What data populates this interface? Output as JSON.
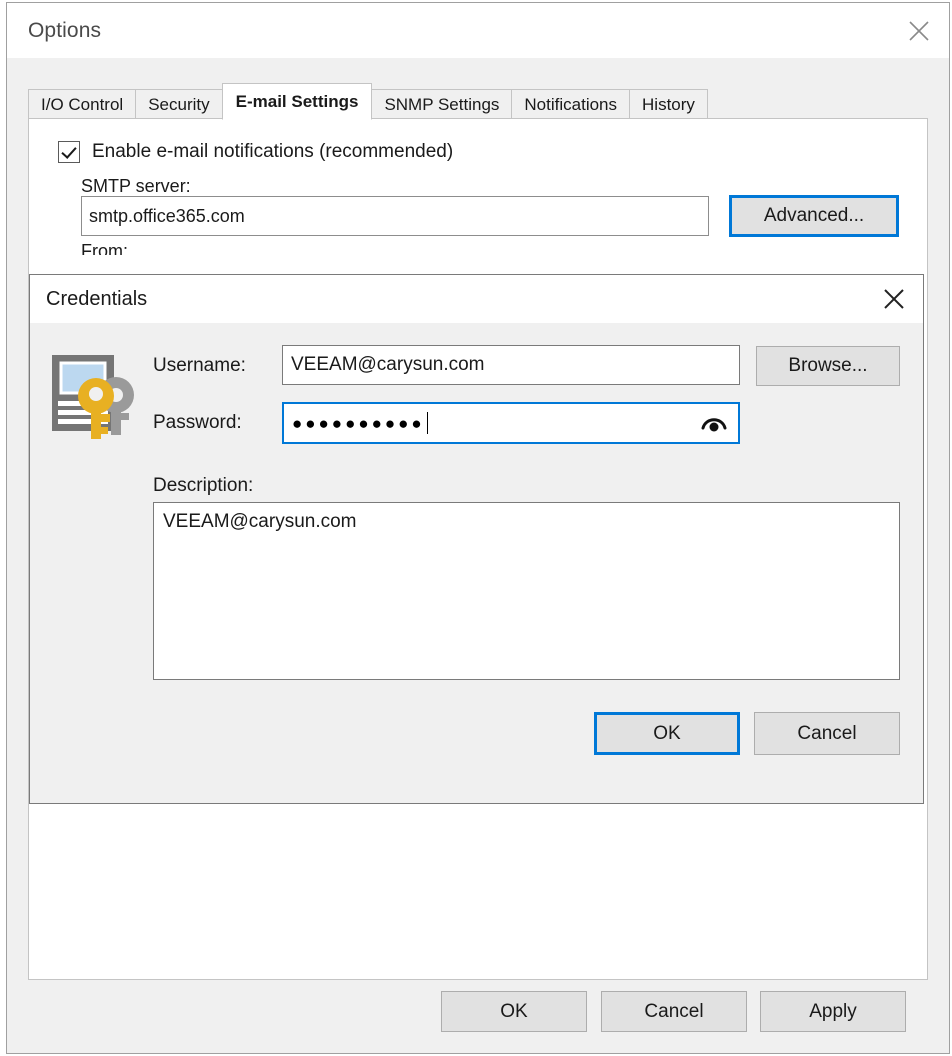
{
  "options": {
    "title": "Options",
    "close_icon": "close-icon",
    "tabs": [
      {
        "label": "I/O Control",
        "active": false
      },
      {
        "label": "Security",
        "active": false
      },
      {
        "label": "E-mail Settings",
        "active": true
      },
      {
        "label": "SNMP Settings",
        "active": false
      },
      {
        "label": "Notifications",
        "active": false
      },
      {
        "label": "History",
        "active": false
      }
    ],
    "email_settings": {
      "enable_checkbox_label": "Enable e-mail notifications (recommended)",
      "enable_checkbox_checked": true,
      "smtp_label": "SMTP server:",
      "smtp_value": "smtp.office365.com",
      "from_label": "From:",
      "advanced_button": "Advanced..."
    },
    "footer": {
      "ok": "OK",
      "cancel": "Cancel",
      "apply": "Apply"
    }
  },
  "credentials": {
    "title": "Credentials",
    "close_icon": "close-icon",
    "icon_name": "credentials-key-icon",
    "username_label": "Username:",
    "username_value": "VEEAM@carysun.com",
    "browse_button": "Browse...",
    "password_label": "Password:",
    "password_value": "●●●●●●●●●●",
    "password_reveal_icon": "eye-icon",
    "description_label": "Description:",
    "description_value": "VEEAM@carysun.com",
    "ok": "OK",
    "cancel": "Cancel"
  },
  "colors": {
    "accent": "#0078d7",
    "window_bg": "#f0f0f0",
    "field_bg": "#ffffff",
    "border": "#8d8d8d",
    "key_gold": "#e8b022",
    "doc_gray": "#757575",
    "doc_blue": "#bcd8f0"
  }
}
